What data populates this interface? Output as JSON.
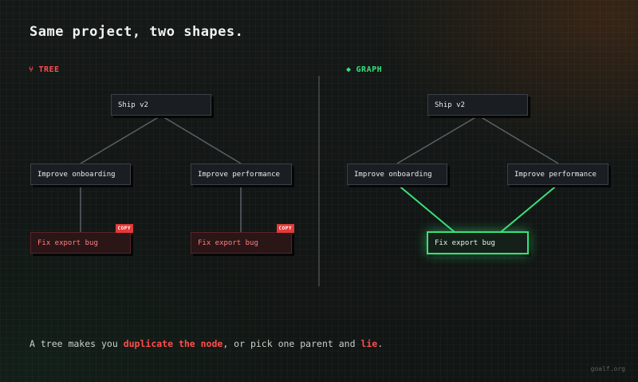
{
  "title": "Same project, two shapes.",
  "tree": {
    "label": "TREE",
    "icon": "branch-icon",
    "root": "Ship v2",
    "left_child": "Improve onboarding",
    "right_child": "Improve performance",
    "left_leaf": "Fix export bug",
    "right_leaf": "Fix export bug",
    "badge": "COPY"
  },
  "graph": {
    "label": "GRAPH",
    "icon": "diamond-icon",
    "root": "Ship v2",
    "left_child": "Improve onboarding",
    "right_child": "Improve performance",
    "shared_leaf": "Fix export bug"
  },
  "caption": {
    "part1": "A tree makes you ",
    "highlight1": "duplicate the node",
    "part2": ", or pick one parent and ",
    "highlight2": "lie",
    "part3": "."
  },
  "watermark": "goalf.org",
  "colors": {
    "tree_accent": "#ff4d4d",
    "graph_accent": "#35e07a",
    "edge": "#5b6068",
    "background": "#121614"
  }
}
